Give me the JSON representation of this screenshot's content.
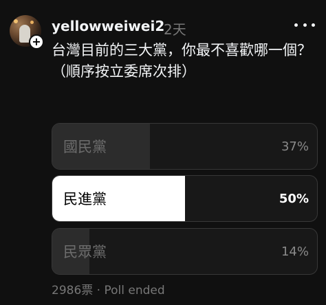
{
  "post": {
    "username": "yellowweiwei2",
    "time": "2天",
    "text": "台灣目前的三大黨，你最不喜歡哪一個？\n（順序按立委席次排）"
  },
  "poll": {
    "options": [
      {
        "label": "國民黨",
        "percent_text": "37%",
        "percent": 37,
        "selected": false
      },
      {
        "label": "民進黨",
        "percent_text": "50%",
        "percent": 50,
        "selected": true
      },
      {
        "label": "民眾黨",
        "percent_text": "14%",
        "percent": 14,
        "selected": false
      }
    ],
    "votes": "2986票",
    "separator": "·",
    "status": "Poll ended"
  },
  "icons": {
    "more": "more-horizontal-icon",
    "follow": "plus-icon"
  },
  "colors": {
    "background": "#101010",
    "selected_fill": "#ffffff",
    "unselected_fill": "#2c2c2c",
    "muted_text": "#777777"
  }
}
